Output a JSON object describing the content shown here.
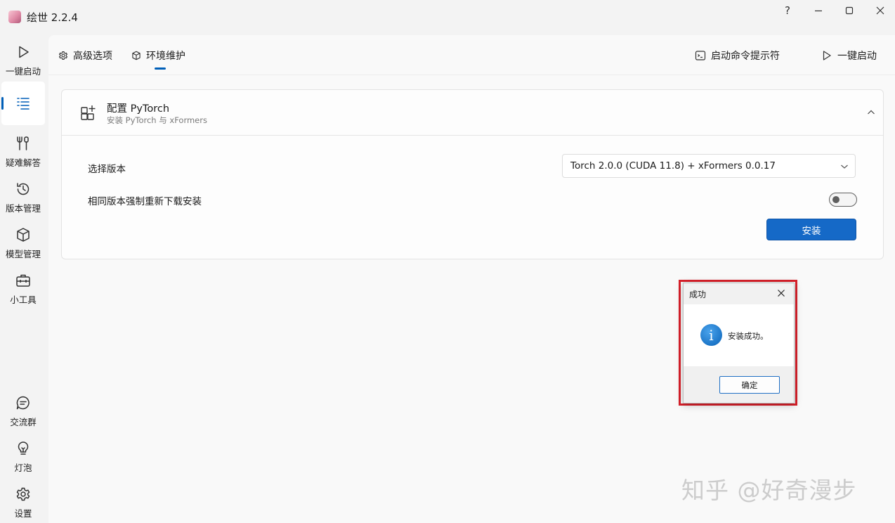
{
  "app": {
    "title": "绘世 2.2.4"
  },
  "window_controls": {
    "help": "?"
  },
  "nav": {
    "top": [
      {
        "label": "一键启动",
        "icon": "play-icon"
      },
      {
        "label": "",
        "icon": "list-icon",
        "active": true
      },
      {
        "label": "疑难解答",
        "icon": "tools-icon"
      },
      {
        "label": "版本管理",
        "icon": "history-icon"
      },
      {
        "label": "模型管理",
        "icon": "cube-icon"
      },
      {
        "label": "小工具",
        "icon": "toolbox-icon"
      }
    ],
    "bottom": [
      {
        "label": "交流群",
        "icon": "chat-icon"
      },
      {
        "label": "灯泡",
        "icon": "lightbulb-icon"
      },
      {
        "label": "设置",
        "icon": "gear-icon"
      }
    ]
  },
  "tabs": [
    {
      "label": "高级选项",
      "icon": "gear-icon"
    },
    {
      "label": "环境维护",
      "icon": "box-icon",
      "active": true
    }
  ],
  "toolbar": {
    "console_label": "启动命令提示符",
    "launch_label": "一键启动"
  },
  "card": {
    "title": "配置 PyTorch",
    "subtitle": "安装 PyTorch 与 xFormers",
    "version_label": "选择版本",
    "version_value": "Torch 2.0.0 (CUDA 11.8) + xFormers 0.0.17",
    "force_label": "相同版本强制重新下载安装",
    "force_enabled": false,
    "install_label": "安装"
  },
  "dialog": {
    "title": "成功",
    "message": "安装成功。",
    "ok_label": "确定",
    "icon": "info-icon"
  },
  "watermark": "知乎 @好奇漫步",
  "colors": {
    "accent": "#005fb8",
    "button": "#1569c7",
    "highlight": "#d9202a"
  }
}
